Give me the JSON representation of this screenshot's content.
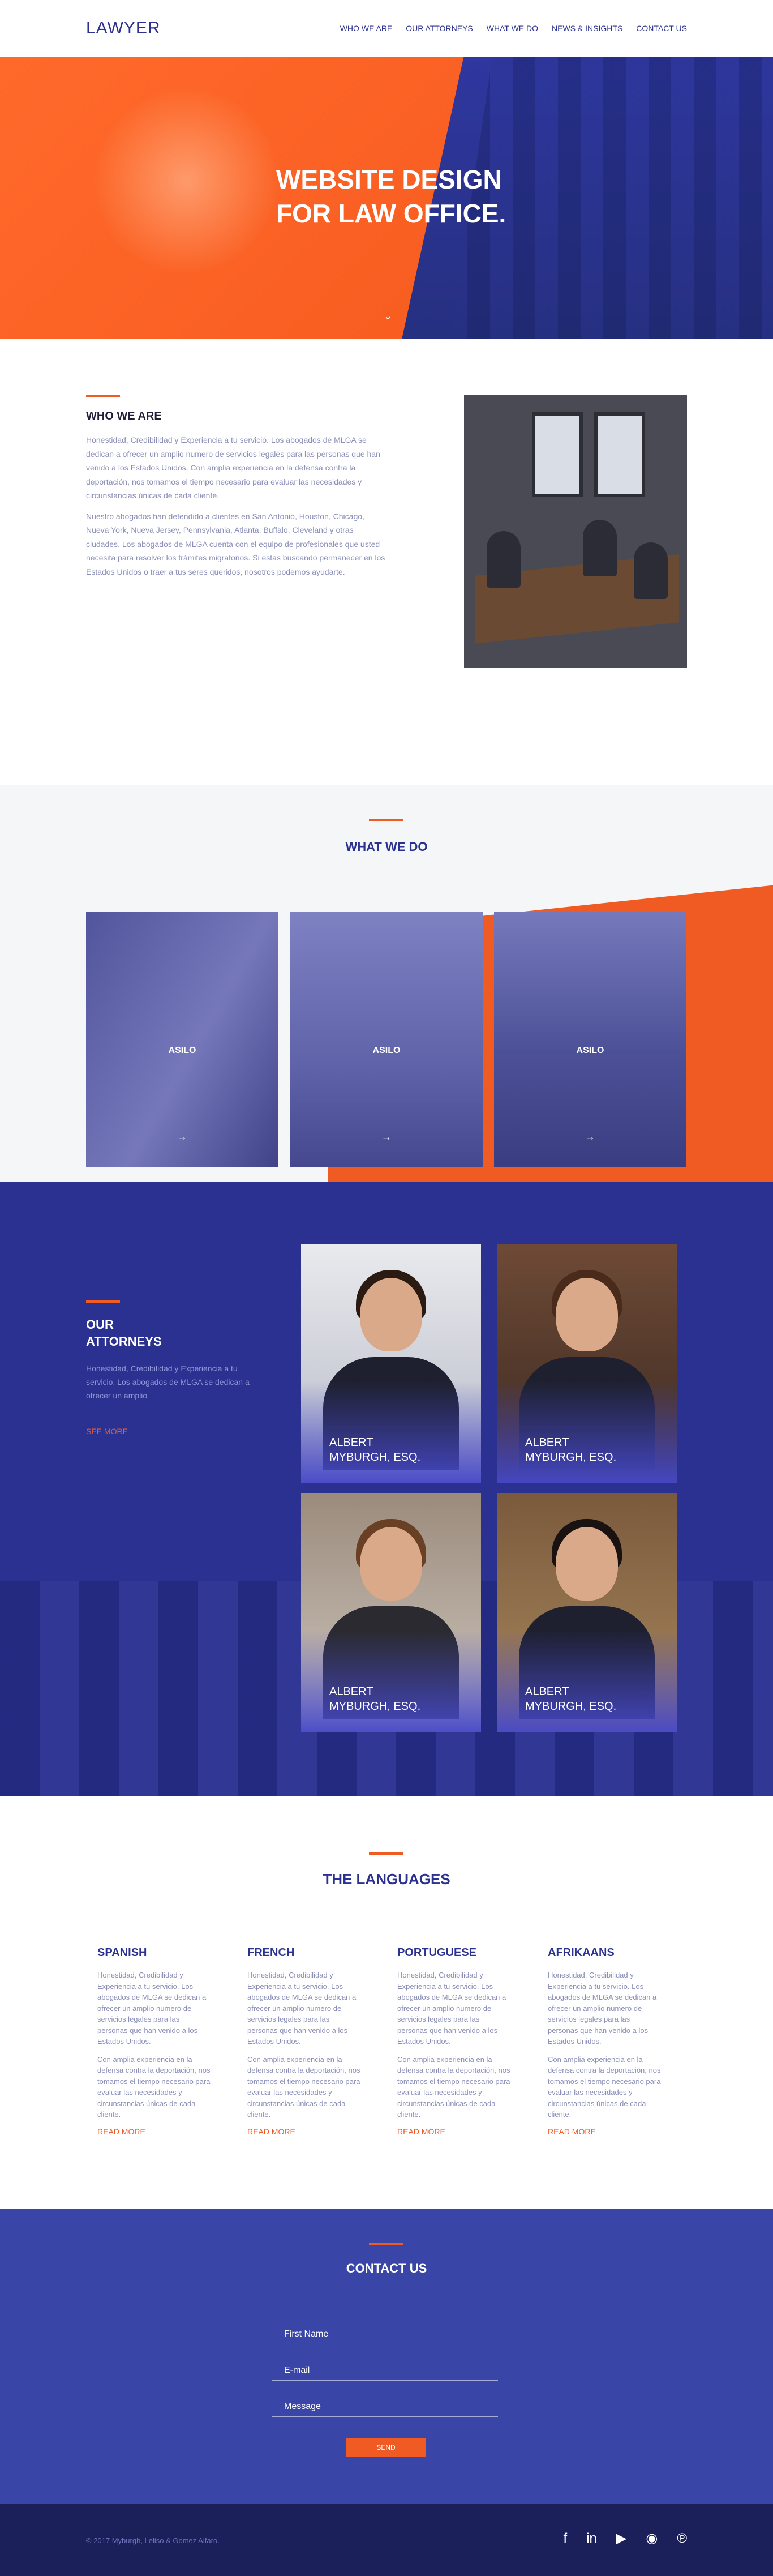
{
  "header": {
    "logo": "LAWYER",
    "nav": [
      "WHO WE ARE",
      "OUR ATTORNEYS",
      "WHAT WE DO",
      "NEWS & INSIGHTS",
      "CONTACT US"
    ]
  },
  "hero": {
    "title_line1": "WEBSITE DESIGN",
    "title_line2": "FOR LAW OFFICE.",
    "scroll_icon": "chevron-down"
  },
  "who": {
    "title": "WHO WE ARE",
    "p1": "Honestidad, Credibilidad y Experiencia a tu servicio. Los abogados de MLGA se dedican a ofrecer un amplio numero de servicios legales para las personas que han venido a los Estados Unidos. Con amplia experiencia en la defensa contra la deportación, nos tomamos el tiempo necesario para evaluar las necesidades y circunstancias únicas de cada cliente.",
    "p2": "Nuestro abogados han defendido a clientes en San Antonio, Houston, Chicago, Nueva York, Nueva Jersey, Pennsylvania, Atlanta, Buffalo, Cleveland y otras ciudades. Los abogados de MLGA cuenta con el equipo de profesionales que usted necesita para resolver los trámites migratorios. Si estas buscando permanecer en los Estados Unidos o traer a tus seres queridos, nosotros podemos ayudarte."
  },
  "whatwedo": {
    "title": "WHAT WE DO",
    "cards": [
      {
        "label": "ASILO",
        "arrow": "→"
      },
      {
        "label": "ASILO",
        "arrow": "→"
      },
      {
        "label": "ASILO",
        "arrow": "→"
      }
    ]
  },
  "attorneys": {
    "title_line1": "OUR",
    "title_line2": "ATTORNEYS",
    "text": "Honestidad, Credibilidad y Experiencia a tu servicio. Los abogados de MLGA se dedican a ofrecer un amplio",
    "link": "SEE MORE",
    "cards": [
      {
        "line1": "ALBERT",
        "line2": "MYBURGH, ESQ."
      },
      {
        "line1": "ALBERT",
        "line2": "MYBURGH, ESQ."
      },
      {
        "line1": "ALBERT",
        "line2": "MYBURGH, ESQ."
      },
      {
        "line1": "ALBERT",
        "line2": "MYBURGH, ESQ."
      }
    ]
  },
  "languages": {
    "title": "THE LANGUAGES",
    "cols": [
      {
        "name": "SPANISH",
        "p1": "Honestidad, Credibilidad y Experiencia a tu servicio. Los abogados de MLGA se dedican a ofrecer un amplio numero de servicios legales para las personas que han venido a los Estados Unidos.",
        "p2": "Con amplia experiencia en la defensa contra la deportación, nos tomamos el tiempo necesario para evaluar las necesidades y circunstancias únicas de cada cliente.",
        "link": "READ MORE"
      },
      {
        "name": "FRENCH",
        "p1": "Honestidad, Credibilidad y Experiencia a tu servicio. Los abogados de MLGA se dedican a ofrecer un amplio numero de servicios legales para las personas que han venido a los Estados Unidos.",
        "p2": "Con amplia experiencia en la defensa contra la deportación, nos tomamos el tiempo necesario para evaluar las necesidades y circunstancias únicas de cada cliente.",
        "link": "READ MORE"
      },
      {
        "name": "PORTUGUESE",
        "p1": "Honestidad, Credibilidad y Experiencia a tu servicio. Los abogados de MLGA se dedican a ofrecer un amplio numero de servicios legales para las personas que han venido a los Estados Unidos.",
        "p2": "Con amplia experiencia en la defensa contra la deportación, nos tomamos el tiempo necesario para evaluar las necesidades y circunstancias únicas de cada cliente.",
        "link": "READ MORE"
      },
      {
        "name": "AFRIKAANS",
        "p1": "Honestidad, Credibilidad y Experiencia a tu servicio. Los abogados de MLGA se dedican a ofrecer un amplio numero de servicios legales para las personas que han venido a los Estados Unidos.",
        "p2": "Con amplia experiencia en la defensa contra la deportación, nos tomamos el tiempo necesario para evaluar las necesidades y circunstancias únicas de cada cliente.",
        "link": "READ MORE"
      }
    ]
  },
  "contact": {
    "title": "CONTACT US",
    "first_name": "First Name",
    "email": "E-mail",
    "message": "Message",
    "send": "SEND"
  },
  "footer": {
    "copyright": "© 2017 Myburgh, Leliso & Gomez Alfaro.",
    "socials": [
      "facebook-icon",
      "linkedin-icon",
      "youtube-icon",
      "instagram-icon",
      "pinterest-icon"
    ]
  },
  "colors": {
    "brand_blue": "#2b3190",
    "accent_orange": "#f05a23",
    "contact_blue": "#3a45a8",
    "footer_navy": "#1b1f5a"
  }
}
